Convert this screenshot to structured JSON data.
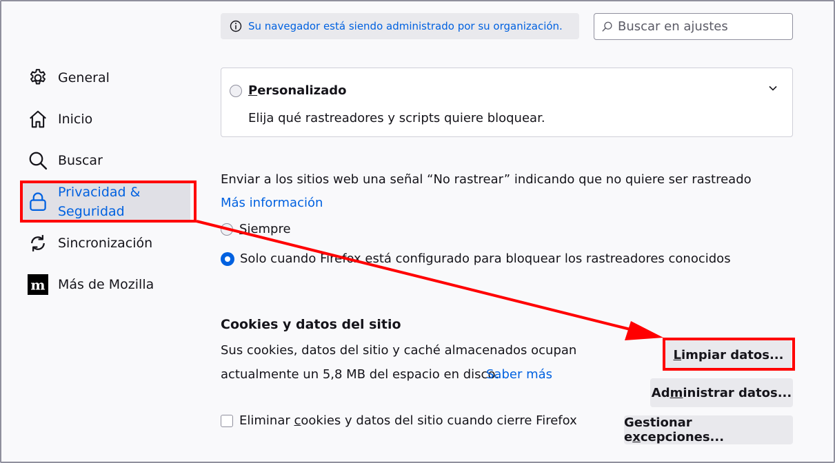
{
  "sidebar": {
    "items": [
      {
        "label": "General",
        "icon": "gear-icon"
      },
      {
        "label": "Inicio",
        "icon": "home-icon"
      },
      {
        "label": "Buscar",
        "icon": "search-icon"
      },
      {
        "label_line1": "Privacidad &",
        "label_line2": "Seguridad",
        "icon": "lock-icon",
        "selected": true
      },
      {
        "label": "Sincronización",
        "icon": "sync-icon"
      },
      {
        "label": "Más de Mozilla",
        "icon": "mozilla-logo-icon"
      }
    ]
  },
  "notice": {
    "text": "Su navegador está siendo administrado por su organización.",
    "icon": "info-icon"
  },
  "search": {
    "placeholder": "Buscar en ajustes",
    "icon": "magnifier-icon"
  },
  "custom_card": {
    "title_first": "P",
    "title_rest": "ersonalizado",
    "description": "Elija qué rastreadores y scripts quiere bloquear.",
    "icon": "chevron-down-icon"
  },
  "dnt": {
    "description": "Enviar a los sitios web una señal “No rastrear” indicando que no quiere ser rastreado",
    "more_info": "Más información",
    "options": [
      {
        "pre": "",
        "u": "S",
        "post": "iempre",
        "selected": false
      },
      {
        "label": "Solo cuando Firefox está configurado para bloquear los rastreadores conocidos",
        "selected": true
      }
    ]
  },
  "cookies": {
    "heading": "Cookies y datos del sitio",
    "line1": "Sus cookies, datos del sitio y caché almacenados ocupan",
    "line2": "actualmente un 5,8 MB del espacio en disco.",
    "learn_more": "Saber más",
    "clear_btn": {
      "pre": "",
      "u": "L",
      "post": "impiar datos..."
    },
    "manage_btn": {
      "pre": "Ad",
      "u": "m",
      "post": "inistrar datos..."
    },
    "exceptions_btn": {
      "pre": "Gestionar e",
      "u": "x",
      "post": "cepciones..."
    },
    "delete_on_close": {
      "pre": "Eliminar ",
      "u": "c",
      "post": "ookies y datos del sitio cuando cierre Firefox",
      "checked": false
    }
  },
  "annotation_color": "#ff0000",
  "accent_color": "#0061e0"
}
